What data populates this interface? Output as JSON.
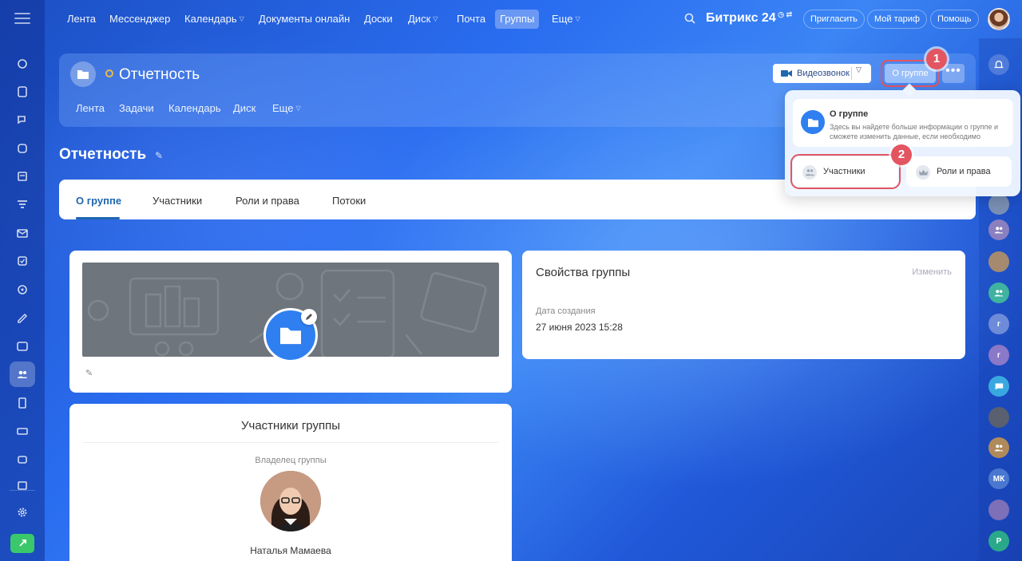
{
  "topnav": {
    "items": [
      {
        "label": "Лента",
        "dropdown": false
      },
      {
        "label": "Мессенджер",
        "dropdown": false
      },
      {
        "label": "Календарь",
        "dropdown": true
      },
      {
        "label": "Документы онлайн",
        "dropdown": false
      },
      {
        "label": "Доски",
        "dropdown": false
      },
      {
        "label": "Диск",
        "dropdown": true
      },
      {
        "label": "Почта",
        "dropdown": false
      },
      {
        "label": "Группы",
        "dropdown": false,
        "active": true
      },
      {
        "label": "Еще",
        "dropdown": true
      }
    ],
    "brand": "Битрикс 24",
    "invite_label": "Пригласить",
    "tariff_label": "Мой тариф",
    "help_label": "Помощь"
  },
  "group": {
    "title": "Отчетность",
    "nav": [
      "Лента",
      "Задачи",
      "Календарь",
      "Диск",
      "Еще"
    ],
    "video_label": "Видеозвонок",
    "about_label": "О группе",
    "more_label": "•••"
  },
  "page": {
    "title": "Отчетность",
    "tabs": [
      "О группе",
      "Участники",
      "Роли и права",
      "Потоки"
    ]
  },
  "popup": {
    "about_title": "О группе",
    "about_desc": "Здесь вы найдете больше информации о группе и сможете изменить данные, если необходимо",
    "members_label": "Участники",
    "roles_label": "Роли и права"
  },
  "badges": {
    "one": "1",
    "two": "2"
  },
  "properties": {
    "title": "Свойства группы",
    "edit_label": "Изменить",
    "created_label": "Дата создания",
    "created_value": "27 июня 2023 15:28"
  },
  "members": {
    "title": "Участники группы",
    "owner_label": "Владелец группы",
    "owner_name": "Наталья Мамаева"
  },
  "right_bar": {
    "initials": [
      "г",
      "г",
      "МК",
      "Р"
    ]
  },
  "colors": {
    "accent": "#2f7ff0",
    "highlight": "#e25561",
    "tab_active": "#2067b0",
    "online_green": "#3bc86b"
  }
}
